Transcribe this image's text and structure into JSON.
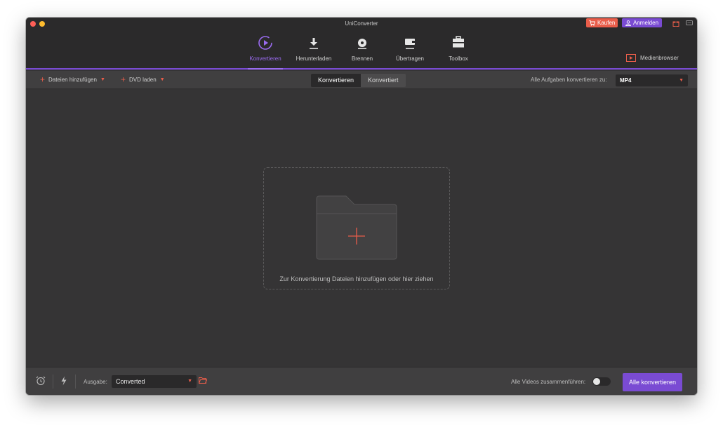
{
  "app": {
    "title": "UniConverter",
    "buy_label": "Kaufen",
    "signin_label": "Anmelden"
  },
  "nav": {
    "tabs": [
      {
        "label": "Konvertieren",
        "icon": "convert-icon",
        "active": true
      },
      {
        "label": "Herunterladen",
        "icon": "download-icon",
        "active": false
      },
      {
        "label": "Brennen",
        "icon": "burn-icon",
        "active": false
      },
      {
        "label": "Übertragen",
        "icon": "transfer-icon",
        "active": false
      },
      {
        "label": "Toolbox",
        "icon": "toolbox-icon",
        "active": false
      }
    ],
    "media_browser_label": "Medienbrowser"
  },
  "toolbar": {
    "add_files_label": "Dateien hinzufügen",
    "load_dvd_label": "DVD laden",
    "segment": {
      "convert_label": "Konvertieren",
      "converted_label": "Konvertiert",
      "active": "Konvertieren"
    },
    "convert_all_to_label": "Alle Aufgaben konvertieren zu:",
    "format_value": "MP4"
  },
  "main": {
    "drop_text": "Zur Konvertierung Dateien hinzufügen oder hier ziehen"
  },
  "bottom": {
    "output_label": "Ausgabe:",
    "output_value": "Converted",
    "merge_label": "Alle Videos zusammenführen:",
    "merge_enabled": false,
    "convert_all_label": "Alle konvertieren"
  },
  "colors": {
    "accent": "#7a4bd3",
    "accent_text": "#9a6bf0",
    "orange": "#e95d4a",
    "window_bg": "#353435"
  }
}
